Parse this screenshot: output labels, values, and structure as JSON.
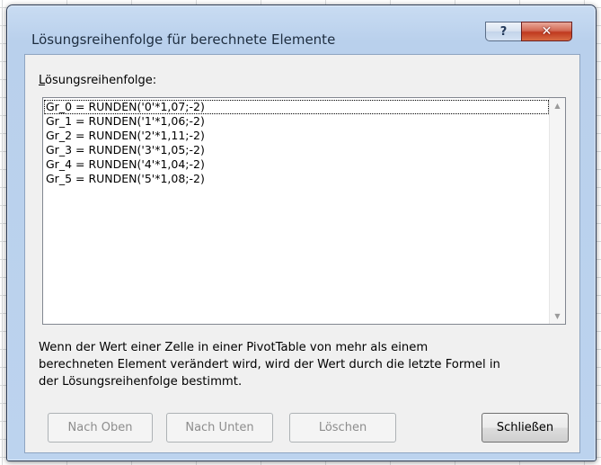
{
  "dialog": {
    "title": "Lösungsreihenfolge für berechnete Elemente",
    "help_button": "?",
    "close_button": "✕"
  },
  "list": {
    "label_underlined": "L",
    "label_rest": "ösungsreihenfolge:",
    "items": [
      "Gr_0 = RUNDEN('0'*1,07;-2)",
      "Gr_1 = RUNDEN('1'*1,06;-2)",
      "Gr_2 = RUNDEN('2'*1,11;-2)",
      "Gr_3 = RUNDEN('3'*1,05;-2)",
      "Gr_4 = RUNDEN('4'*1,04;-2)",
      "Gr_5 = RUNDEN('5'*1,08;-2)"
    ],
    "selected_index": 0
  },
  "explanation": {
    "lines": [
      "Wenn der Wert einer Zelle in einer PivotTable von mehr als einem",
      "berechneten Element verändert wird, wird der Wert durch die letzte Formel in",
      "der Lösungsreihenfolge bestimmt."
    ]
  },
  "buttons": {
    "move_up": "Nach Oben",
    "move_down": "Nach Unten",
    "delete": "Löschen",
    "close": "Schließen"
  },
  "icons": {
    "scroll_up": "▲",
    "scroll_down": "▼"
  },
  "colors": {
    "title_bar": "#c9dcf2",
    "close_button": "#c0391f",
    "client_bg": "#f0f0f0"
  }
}
